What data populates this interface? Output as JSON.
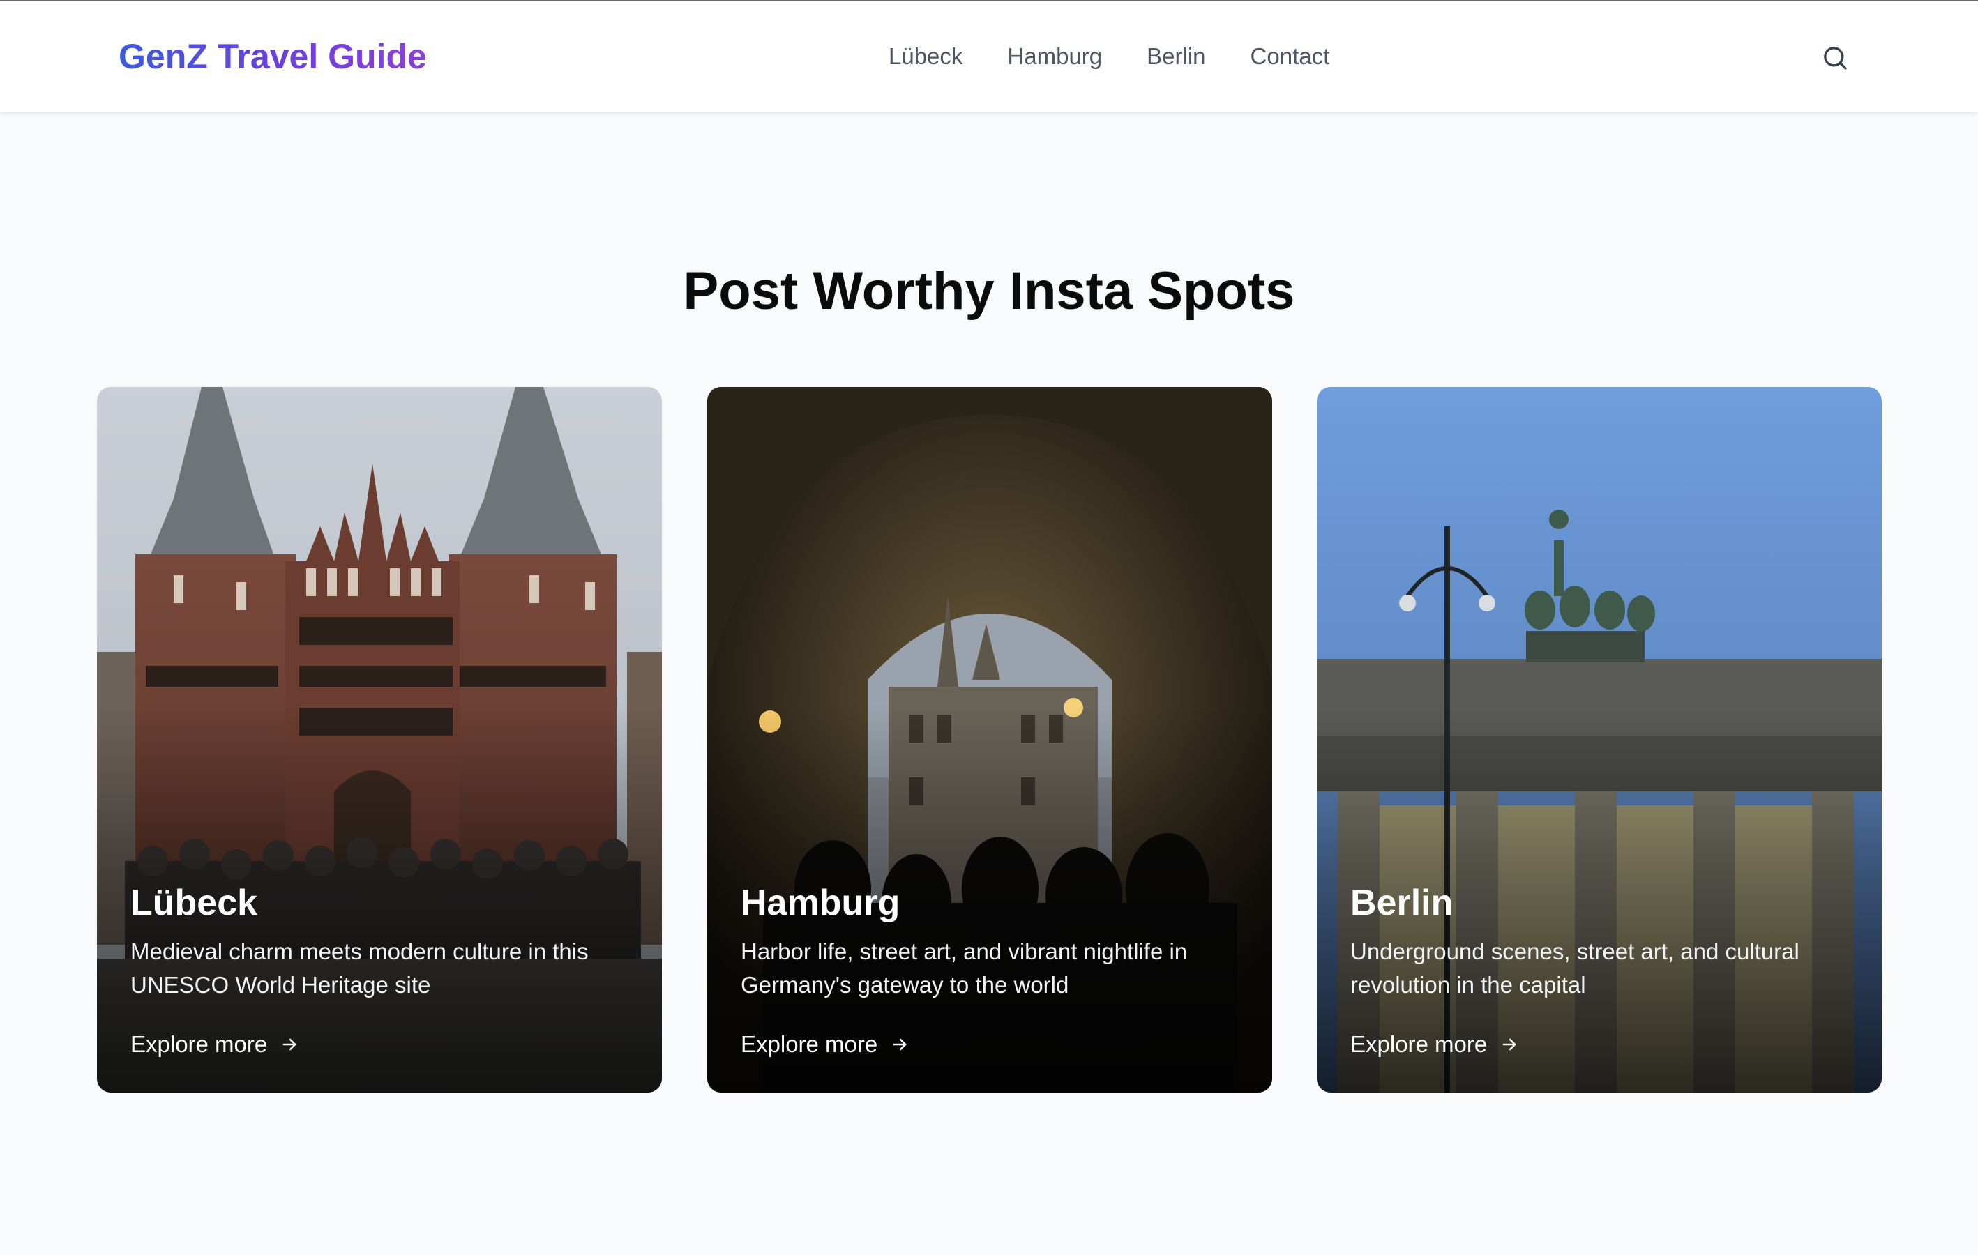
{
  "header": {
    "logo": "GenZ Travel Guide",
    "nav": [
      "Lübeck",
      "Hamburg",
      "Berlin",
      "Contact"
    ],
    "search_icon": "search-icon"
  },
  "section": {
    "title": "Post Worthy Insta Spots"
  },
  "cards": [
    {
      "title": "Lübeck",
      "description": "Medieval charm meets modern culture in this UNESCO World Heritage site",
      "link": "Explore more",
      "link_icon": "arrow-right-icon"
    },
    {
      "title": "Hamburg",
      "description": "Harbor life, street art, and vibrant nightlife in Germany's gateway to the world",
      "link": "Explore more",
      "link_icon": "arrow-right-icon"
    },
    {
      "title": "Berlin",
      "description": "Underground scenes, street art, and cultural revolution in the capital",
      "link": "Explore more",
      "link_icon": "arrow-right-icon"
    }
  ],
  "colors": {
    "logo_gradient_start": "#3b5bdb",
    "logo_gradient_end": "#8b3fd9",
    "nav_text": "#4b5563",
    "page_background": "#f9fafb",
    "title_text": "#0b0b0b"
  }
}
